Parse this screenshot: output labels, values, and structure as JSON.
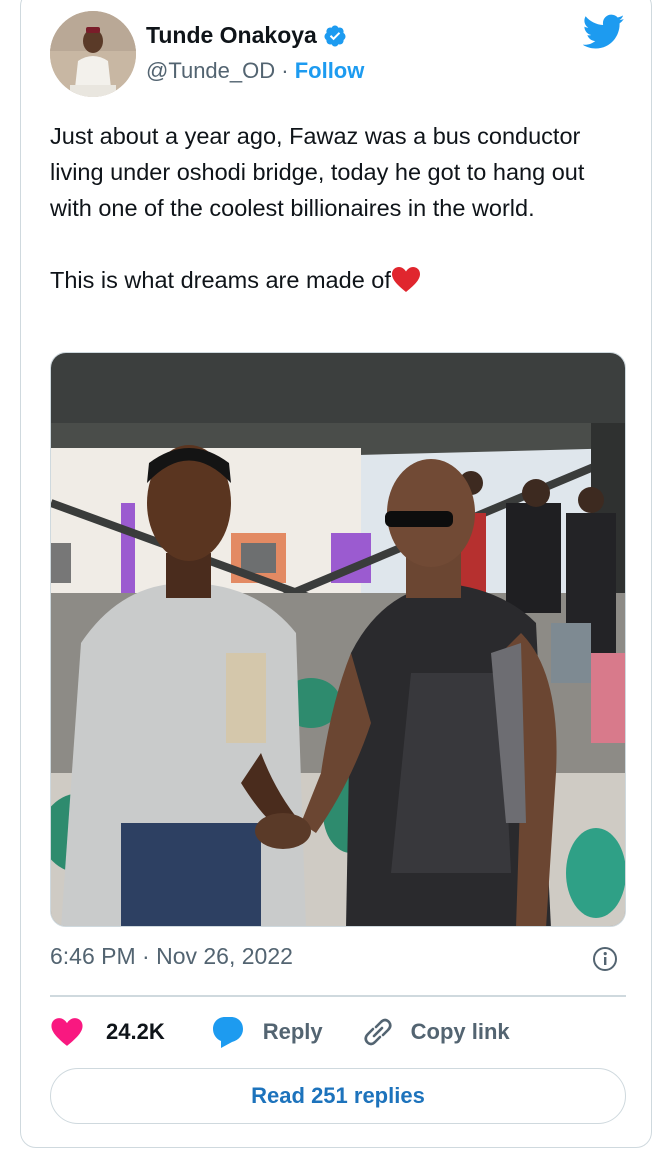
{
  "tweet": {
    "author_name": "Tunde Onakoya",
    "handle": "@Tunde_OD",
    "separator": " · ",
    "follow_label": "Follow",
    "paragraph1": "Just about a year ago, Fawaz was a bus conductor living under oshodi bridge, today he got to hang out with one of the coolest billionaires in the world.",
    "paragraph2": "This is what dreams are made of",
    "timestamp": "6:46 PM · Nov 26, 2022"
  },
  "actions": {
    "like_count": "24.2K",
    "reply_label": "Reply",
    "copy_link_label": "Copy link",
    "read_replies_label": "Read 251 replies"
  },
  "icons": {
    "verified": "verified-badge-icon",
    "platform": "twitter-bird-icon",
    "info": "info-icon",
    "like": "heart-icon",
    "reply": "speech-bubble-icon",
    "copy": "link-icon"
  },
  "colors": {
    "accent": "#1d9bf0",
    "like": "#f91880",
    "text": "#0f1419",
    "muted": "#536471",
    "border": "#cfd9de"
  }
}
